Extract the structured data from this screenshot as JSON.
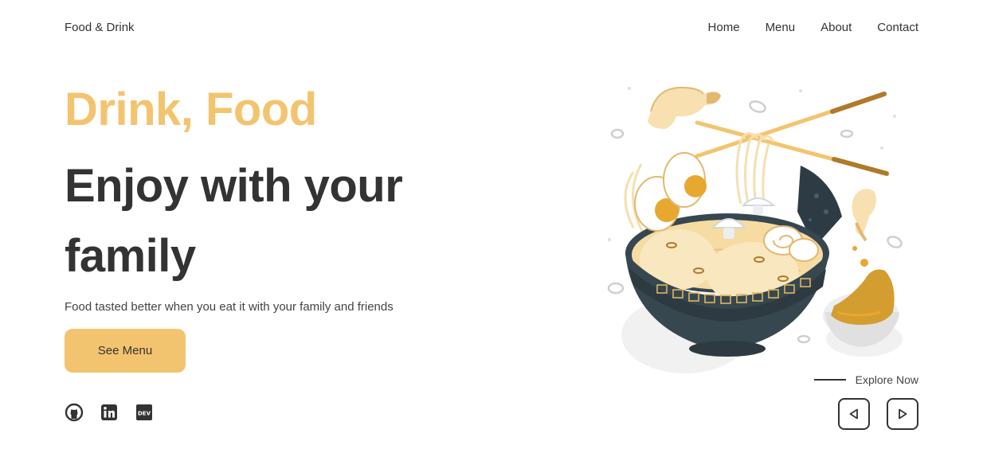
{
  "header": {
    "brand": "Food & Drink",
    "nav": [
      "Home",
      "Menu",
      "About",
      "Contact"
    ]
  },
  "hero": {
    "accent": "Drink, Food",
    "title": "Enjoy with your family",
    "subtitle": "Food tasted better when you eat it with your family and friends",
    "cta_label": "See Menu"
  },
  "socials": [
    "github-icon",
    "linkedin-icon",
    "dev-icon"
  ],
  "explore": {
    "label": "Explore Now"
  },
  "colors": {
    "accent": "#f3c46f",
    "text": "#333333",
    "bowl": "#37474f"
  }
}
